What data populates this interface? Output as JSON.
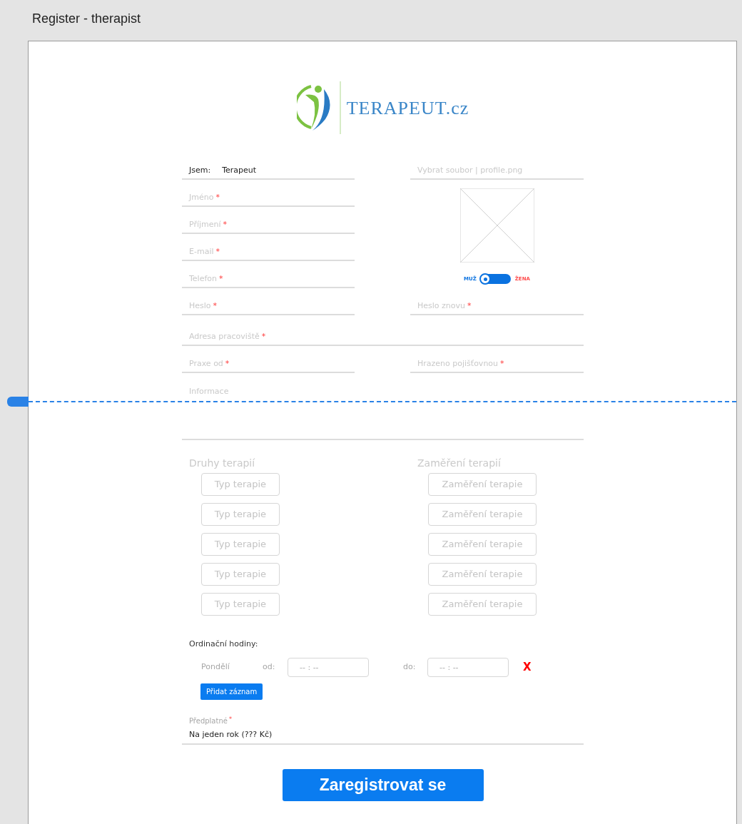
{
  "window": {
    "title": "Register - therapist"
  },
  "logo": {
    "text": "TERAPEUT.cz"
  },
  "role_field": {
    "label": "Jsem:",
    "value": "Terapeut"
  },
  "file_field": {
    "placeholder": "Vybrat soubor | profile.png"
  },
  "fields_left": [
    {
      "placeholder": "Jméno",
      "mark": "*"
    },
    {
      "placeholder": "Příjmení",
      "mark": "*"
    },
    {
      "placeholder": "E-mail",
      "mark": "*"
    },
    {
      "placeholder": "Telefon",
      "mark": "*"
    },
    {
      "placeholder": "Heslo",
      "mark": "*"
    }
  ],
  "gender_switch": {
    "left_label": "MUŽ",
    "right_label": "ŽENA",
    "on": false
  },
  "password_repeat": {
    "placeholder": "Heslo znovu",
    "mark": "*"
  },
  "address": {
    "placeholder": "Adresa pracoviště",
    "mark": "*"
  },
  "practice_since": {
    "placeholder": "Praxe od",
    "mark": "*"
  },
  "insurance": {
    "placeholder": "Hrazeno pojišťovnou",
    "mark": "*"
  },
  "info": {
    "placeholder": "Informace"
  },
  "therapy_types": {
    "heading": "Druhy terapií",
    "items": [
      "Typ terapie",
      "Typ terapie",
      "Typ terapie",
      "Typ terapie",
      "Typ terapie"
    ]
  },
  "therapy_focus": {
    "heading": "Zaměření terapií",
    "items": [
      "Zaměření terapie",
      "Zaměření terapie",
      "Zaměření terapie",
      "Zaměření terapie",
      "Zaměření terapie"
    ]
  },
  "office_hours": {
    "label": "Ordinační hodiny:",
    "rows": [
      {
        "day": "Pondělí",
        "from_label": "od:",
        "from": "-- : --",
        "to_label": "do:",
        "to": "-- : --",
        "remove": "X"
      }
    ],
    "add_button": "Přidat záznam"
  },
  "subscription": {
    "label": "Předplatné",
    "mark": "*",
    "value": "Na jeden rok (??? Kč)"
  },
  "submit": "Zaregistrovat se"
}
